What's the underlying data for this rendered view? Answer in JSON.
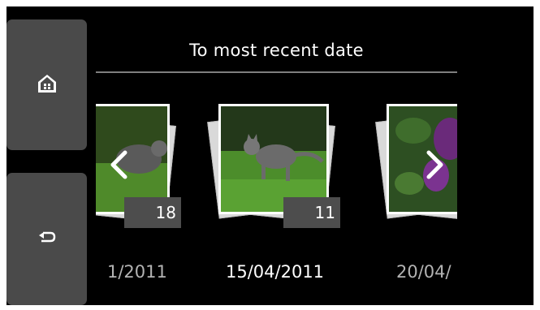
{
  "header": {
    "title": "To most recent date"
  },
  "sidebar": {
    "home_icon": "home-icon",
    "back_icon": "back-icon"
  },
  "photos": [
    {
      "count": "18",
      "date": "1/2011",
      "subject": "cat-on-grass"
    },
    {
      "count": "11",
      "date": "15/04/2011",
      "subject": "cat-on-grass"
    },
    {
      "count": "",
      "date": "20/04/",
      "subject": "purple-flowers"
    }
  ],
  "navigation": {
    "prev_icon": "chevron-left-icon",
    "next_icon": "chevron-right-icon"
  },
  "colors": {
    "background": "#000000",
    "side_button": "#4a4a4a",
    "badge": "#4d4d4d",
    "text": "#ffffff"
  }
}
